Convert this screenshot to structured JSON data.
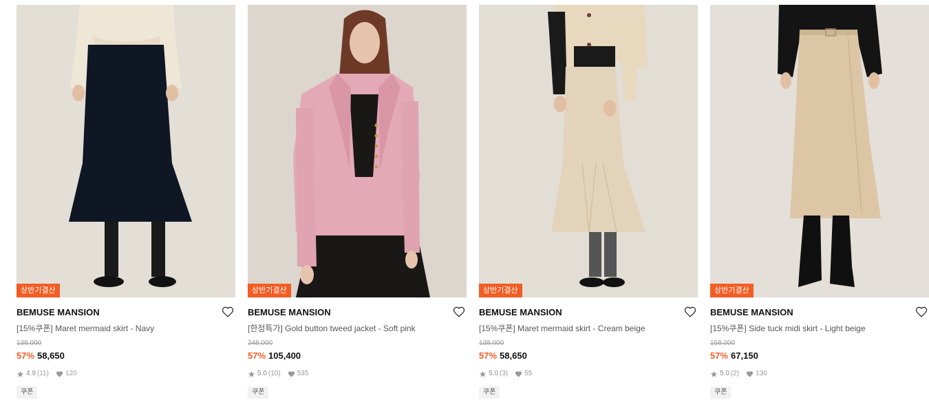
{
  "products": [
    {
      "tag": "상반기결산",
      "brand": "BEMUSE MANSION",
      "name": "[15%쿠폰] Maret mermaid skirt - Navy",
      "original_price": "138,000",
      "discount": "57%",
      "price": "58,650",
      "rating": "4.9",
      "review_count": "(11)",
      "likes": "120",
      "coupon": "쿠폰",
      "image": {
        "bg": "#e3ded6",
        "top": "#efe7d6",
        "garment": "#0f1624",
        "shoes": "#121212"
      }
    },
    {
      "tag": "상반기결산",
      "brand": "BEMUSE MANSION",
      "name": "[한정특가] Gold button tweed jacket - Soft pink",
      "original_price": "248,000",
      "discount": "57%",
      "price": "105,400",
      "rating": "5.0",
      "review_count": "(10)",
      "likes": "535",
      "coupon": "쿠폰",
      "image": {
        "bg": "#dcd6cf",
        "jacket": "#e4a9b7",
        "dress": "#1a1717",
        "hair": "#6e3a27"
      }
    },
    {
      "tag": "상반기결산",
      "brand": "BEMUSE MANSION",
      "name": "[15%쿠폰] Maret mermaid skirt - Cream beige",
      "original_price": "138,000",
      "discount": "57%",
      "price": "58,650",
      "rating": "5.0",
      "review_count": "(3)",
      "likes": "55",
      "coupon": "쿠폰",
      "image": {
        "bg": "#e2ddd5",
        "top": "#e8d8be",
        "garment": "#e3d3bb",
        "shoes": "#121212"
      }
    },
    {
      "tag": "상반기결산",
      "brand": "BEMUSE MANSION",
      "name": "[15%쿠폰] Side tuck midi skirt - Light beige",
      "original_price": "158,000",
      "discount": "57%",
      "price": "67,150",
      "rating": "5.0",
      "review_count": "(2)",
      "likes": "130",
      "coupon": "쿠폰",
      "image": {
        "bg": "#e4dfd8",
        "top": "#141414",
        "garment": "#dcc6a6",
        "shoes": "#101010"
      }
    }
  ],
  "colors": {
    "accent": "#f35d23",
    "muted": "#999999",
    "text": "#111111"
  },
  "icons": {
    "wishlist": "heart-outline-icon",
    "rating": "star-icon",
    "likes": "heart-filled-icon"
  }
}
